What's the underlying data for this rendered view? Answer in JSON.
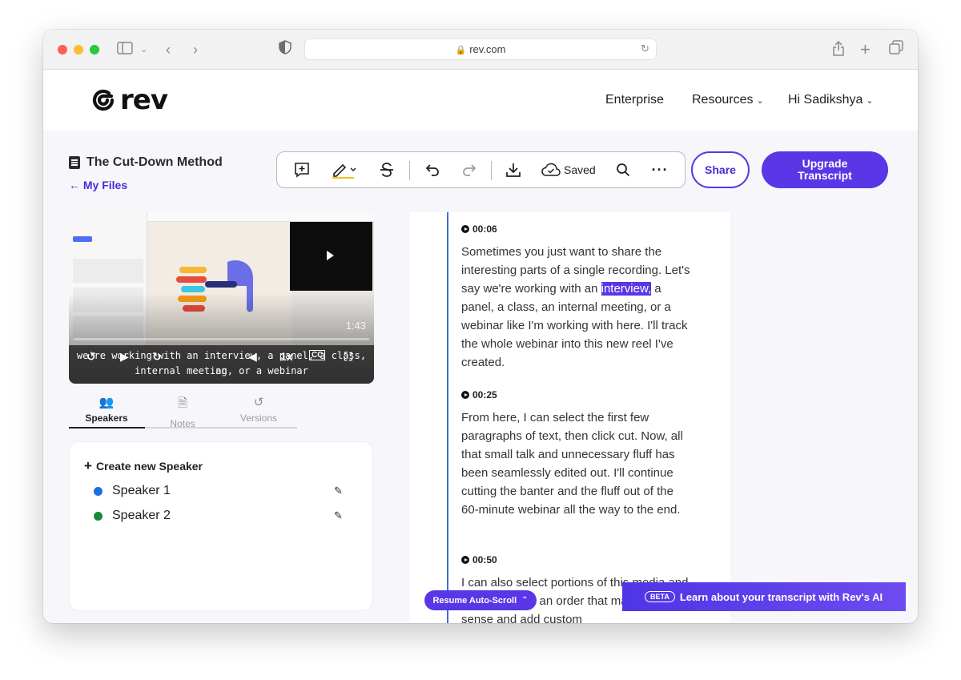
{
  "browser": {
    "url": "rev.com"
  },
  "site": {
    "logo": "rev",
    "nav": {
      "enterprise": "Enterprise",
      "resources": "Resources",
      "user": "Hi Sadikshya"
    }
  },
  "file": {
    "title": "The Cut-Down Method",
    "back_link": "← My Files"
  },
  "toolbar": {
    "saved_label": "Saved"
  },
  "actions": {
    "share": "Share",
    "upgrade_line1": "Upgrade",
    "upgrade_line2": "Transcript"
  },
  "video": {
    "duration": "1:43",
    "caption_line1": "we're working with an interview, a panel, a class, an",
    "caption_line2": "internal meeting, or a webinar",
    "speed": "1x"
  },
  "tabs": [
    {
      "label": "Speakers"
    },
    {
      "label": "Notes"
    },
    {
      "label": "Versions"
    }
  ],
  "speakers": {
    "create_label": "Create new Speaker",
    "items": [
      {
        "name": "Speaker 1",
        "color": "#1a6fe0"
      },
      {
        "name": "Speaker 2",
        "color": "#168a3a"
      }
    ]
  },
  "transcript": {
    "blocks": [
      {
        "time": "00:06",
        "pre": "Sometimes you just want to share the interesting parts of a single recording. Let's say we're working with an ",
        "highlight": "interview,",
        "post": " a panel, a class, an internal meeting, or a webinar like I'm working with here. I'll track the whole webinar into this new reel I've created."
      },
      {
        "time": "00:25",
        "text": "From here, I can select the first few paragraphs of text, then click cut. Now, all that small talk and unnecessary fluff has been seamlessly edited out. I'll continue cutting the banter and the fluff out of the 60-minute webinar all the way to the end."
      },
      {
        "time": "00:50",
        "text": "I can also select portions of this media and rearrange into an order that makes more sense and add custom"
      }
    ]
  },
  "bottom": {
    "resume": "Resume Auto-Scroll",
    "beta": "BETA",
    "ai_banner": "Learn about your transcript with Rev's AI"
  }
}
